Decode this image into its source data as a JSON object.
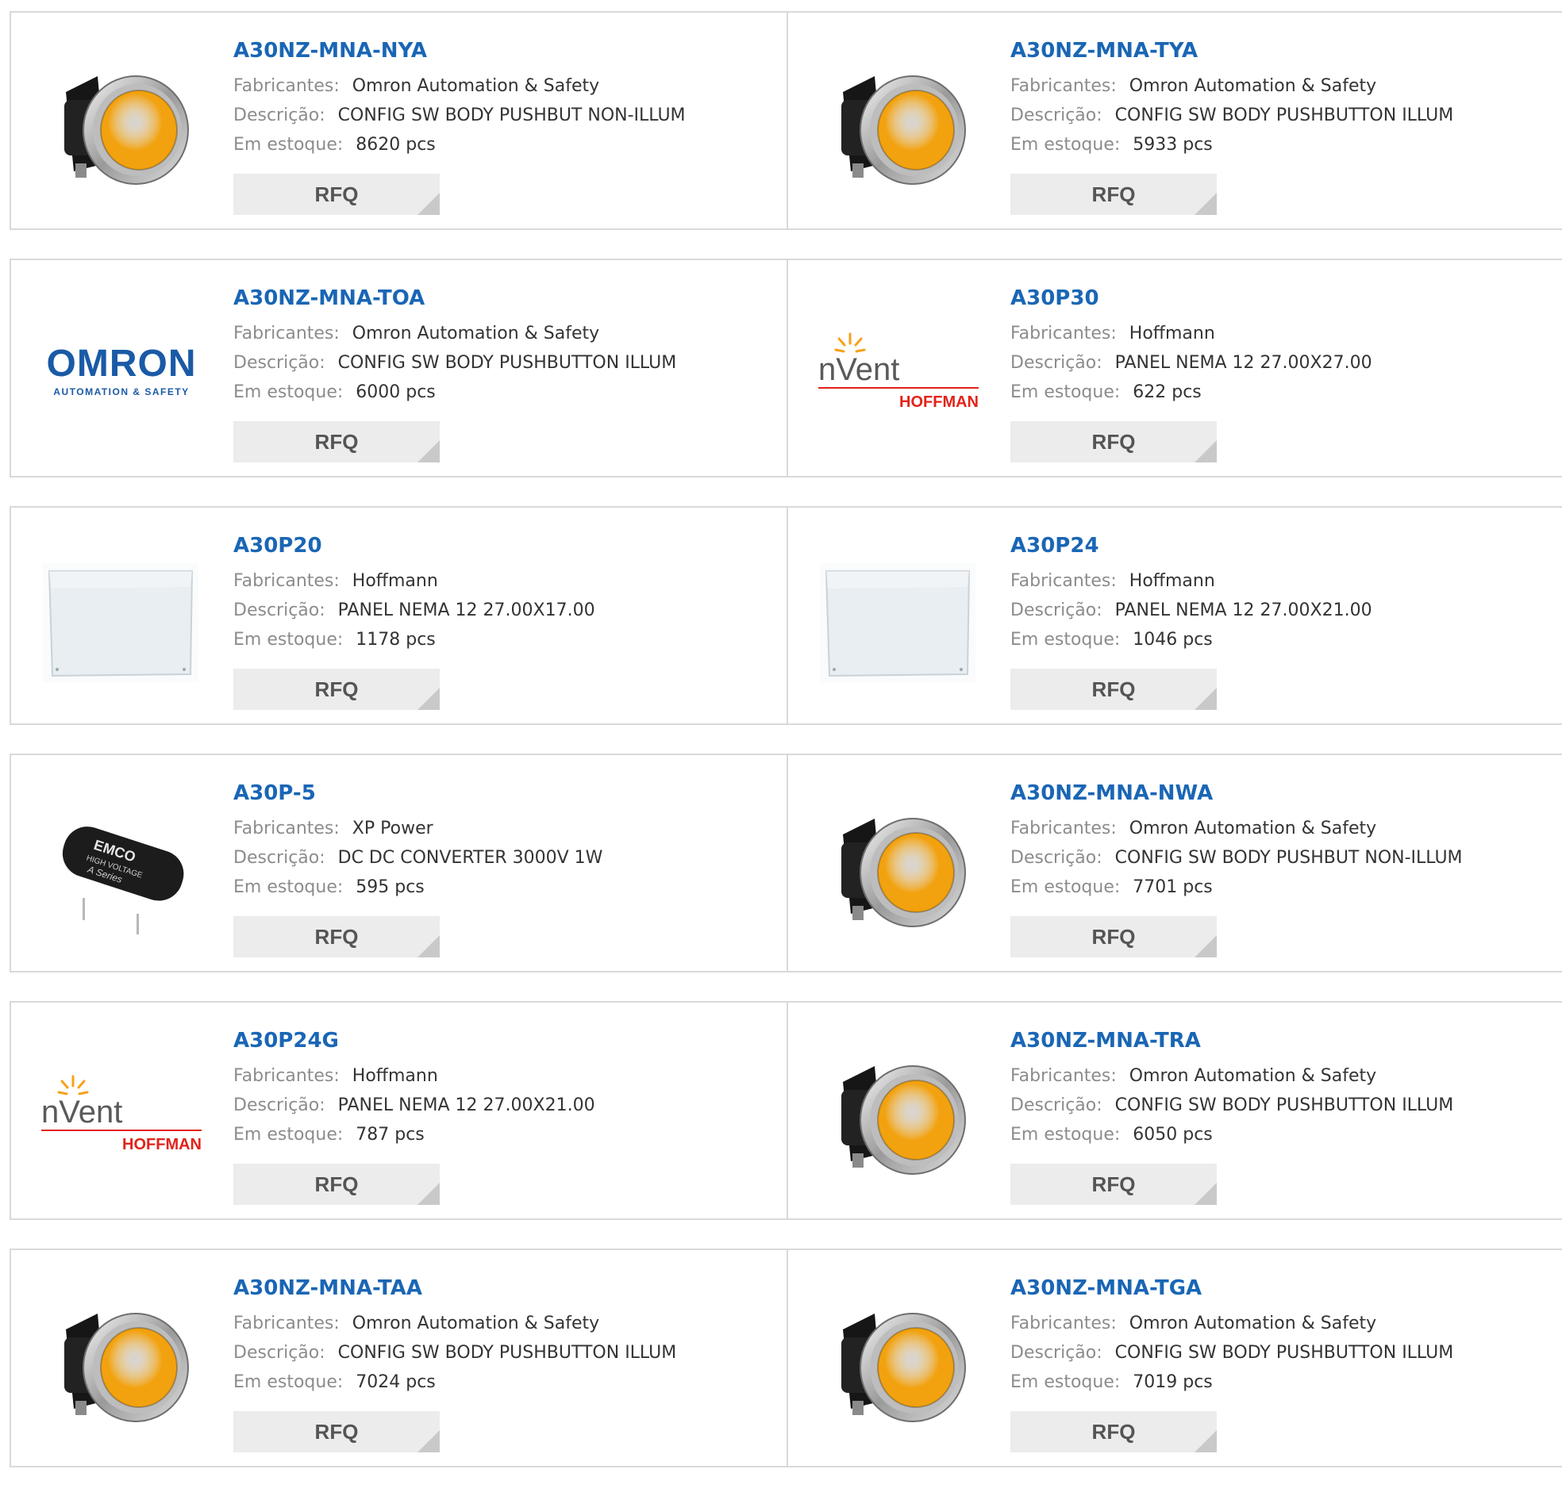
{
  "labels": {
    "manufacturer": "Fabricantes:",
    "description": "Descrição:",
    "stock": "Em estoque:",
    "rfq": "RFQ"
  },
  "products": [
    {
      "part": "A30NZ-MNA-NYA",
      "manufacturer": "Omron Automation & Safety",
      "description": "CONFIG SW BODY PUSHBUT NON-ILLUM",
      "stock": "8620 pcs",
      "image": "pushbutton-yellow",
      "color": "#f2a20f"
    },
    {
      "part": "A30NZ-MNA-TYA",
      "manufacturer": "Omron Automation & Safety",
      "description": "CONFIG SW BODY PUSHBUTTON ILLUM",
      "stock": "5933 pcs",
      "image": "pushbutton-yellow",
      "color": "#f0a000"
    },
    {
      "part": "A30NZ-MNA-TOA",
      "manufacturer": "Omron Automation & Safety",
      "description": "CONFIG SW BODY PUSHBUTTON ILLUM",
      "stock": "6000 pcs",
      "image": "omron-logo",
      "logo_text": "OMRON",
      "logo_sub": "AUTOMATION & SAFETY",
      "color": "#1a5aa6"
    },
    {
      "part": "A30P30",
      "manufacturer": "Hoffmann",
      "description": "PANEL NEMA 12 27.00X27.00",
      "stock": "622 pcs",
      "image": "nvent-hoffman-logo",
      "logo_text": "nVent",
      "logo_sub": "HOFFMAN",
      "color": "#e2231a"
    },
    {
      "part": "A30P20",
      "manufacturer": "Hoffmann",
      "description": "PANEL NEMA 12 27.00X17.00",
      "stock": "1178 pcs",
      "image": "white-panel",
      "color": "#e8eef2"
    },
    {
      "part": "A30P24",
      "manufacturer": "Hoffmann",
      "description": "PANEL NEMA 12 27.00X21.00",
      "stock": "1046 pcs",
      "image": "white-panel",
      "color": "#e8eef2"
    },
    {
      "part": "A30P-5",
      "manufacturer": "XP Power",
      "description": "DC DC CONVERTER 3000V 1W",
      "stock": "595 pcs",
      "image": "emco-converter",
      "logo_text": "EMCO",
      "logo_sub": "HIGH VOLTAGE",
      "logo_sub2": "A Series",
      "color": "#1c1c1c"
    },
    {
      "part": "A30NZ-MNA-NWA",
      "manufacturer": "Omron Automation & Safety",
      "description": "CONFIG SW BODY PUSHBUT NON-ILLUM",
      "stock": "7701 pcs",
      "image": "pushbutton-white",
      "color": "#eef2f0"
    },
    {
      "part": "A30P24G",
      "manufacturer": "Hoffmann",
      "description": "PANEL NEMA 12 27.00X21.00",
      "stock": "787 pcs",
      "image": "nvent-hoffman-logo",
      "logo_text": "nVent",
      "logo_sub": "HOFFMAN",
      "color": "#e2231a"
    },
    {
      "part": "A30NZ-MNA-TRA",
      "manufacturer": "Omron Automation & Safety",
      "description": "CONFIG SW BODY PUSHBUTTON ILLUM",
      "stock": "6050 pcs",
      "image": "pushbutton-red",
      "color": "#c41e14"
    },
    {
      "part": "A30NZ-MNA-TAA",
      "manufacturer": "Omron Automation & Safety",
      "description": "CONFIG SW BODY PUSHBUTTON ILLUM",
      "stock": "7024 pcs",
      "image": "pushbutton-blue",
      "color": "#1f2fc4"
    },
    {
      "part": "A30NZ-MNA-TGA",
      "manufacturer": "Omron Automation & Safety",
      "description": "CONFIG SW BODY PUSHBUTTON ILLUM",
      "stock": "7019 pcs",
      "image": "pushbutton-green",
      "color": "#0d8a3f"
    }
  ]
}
